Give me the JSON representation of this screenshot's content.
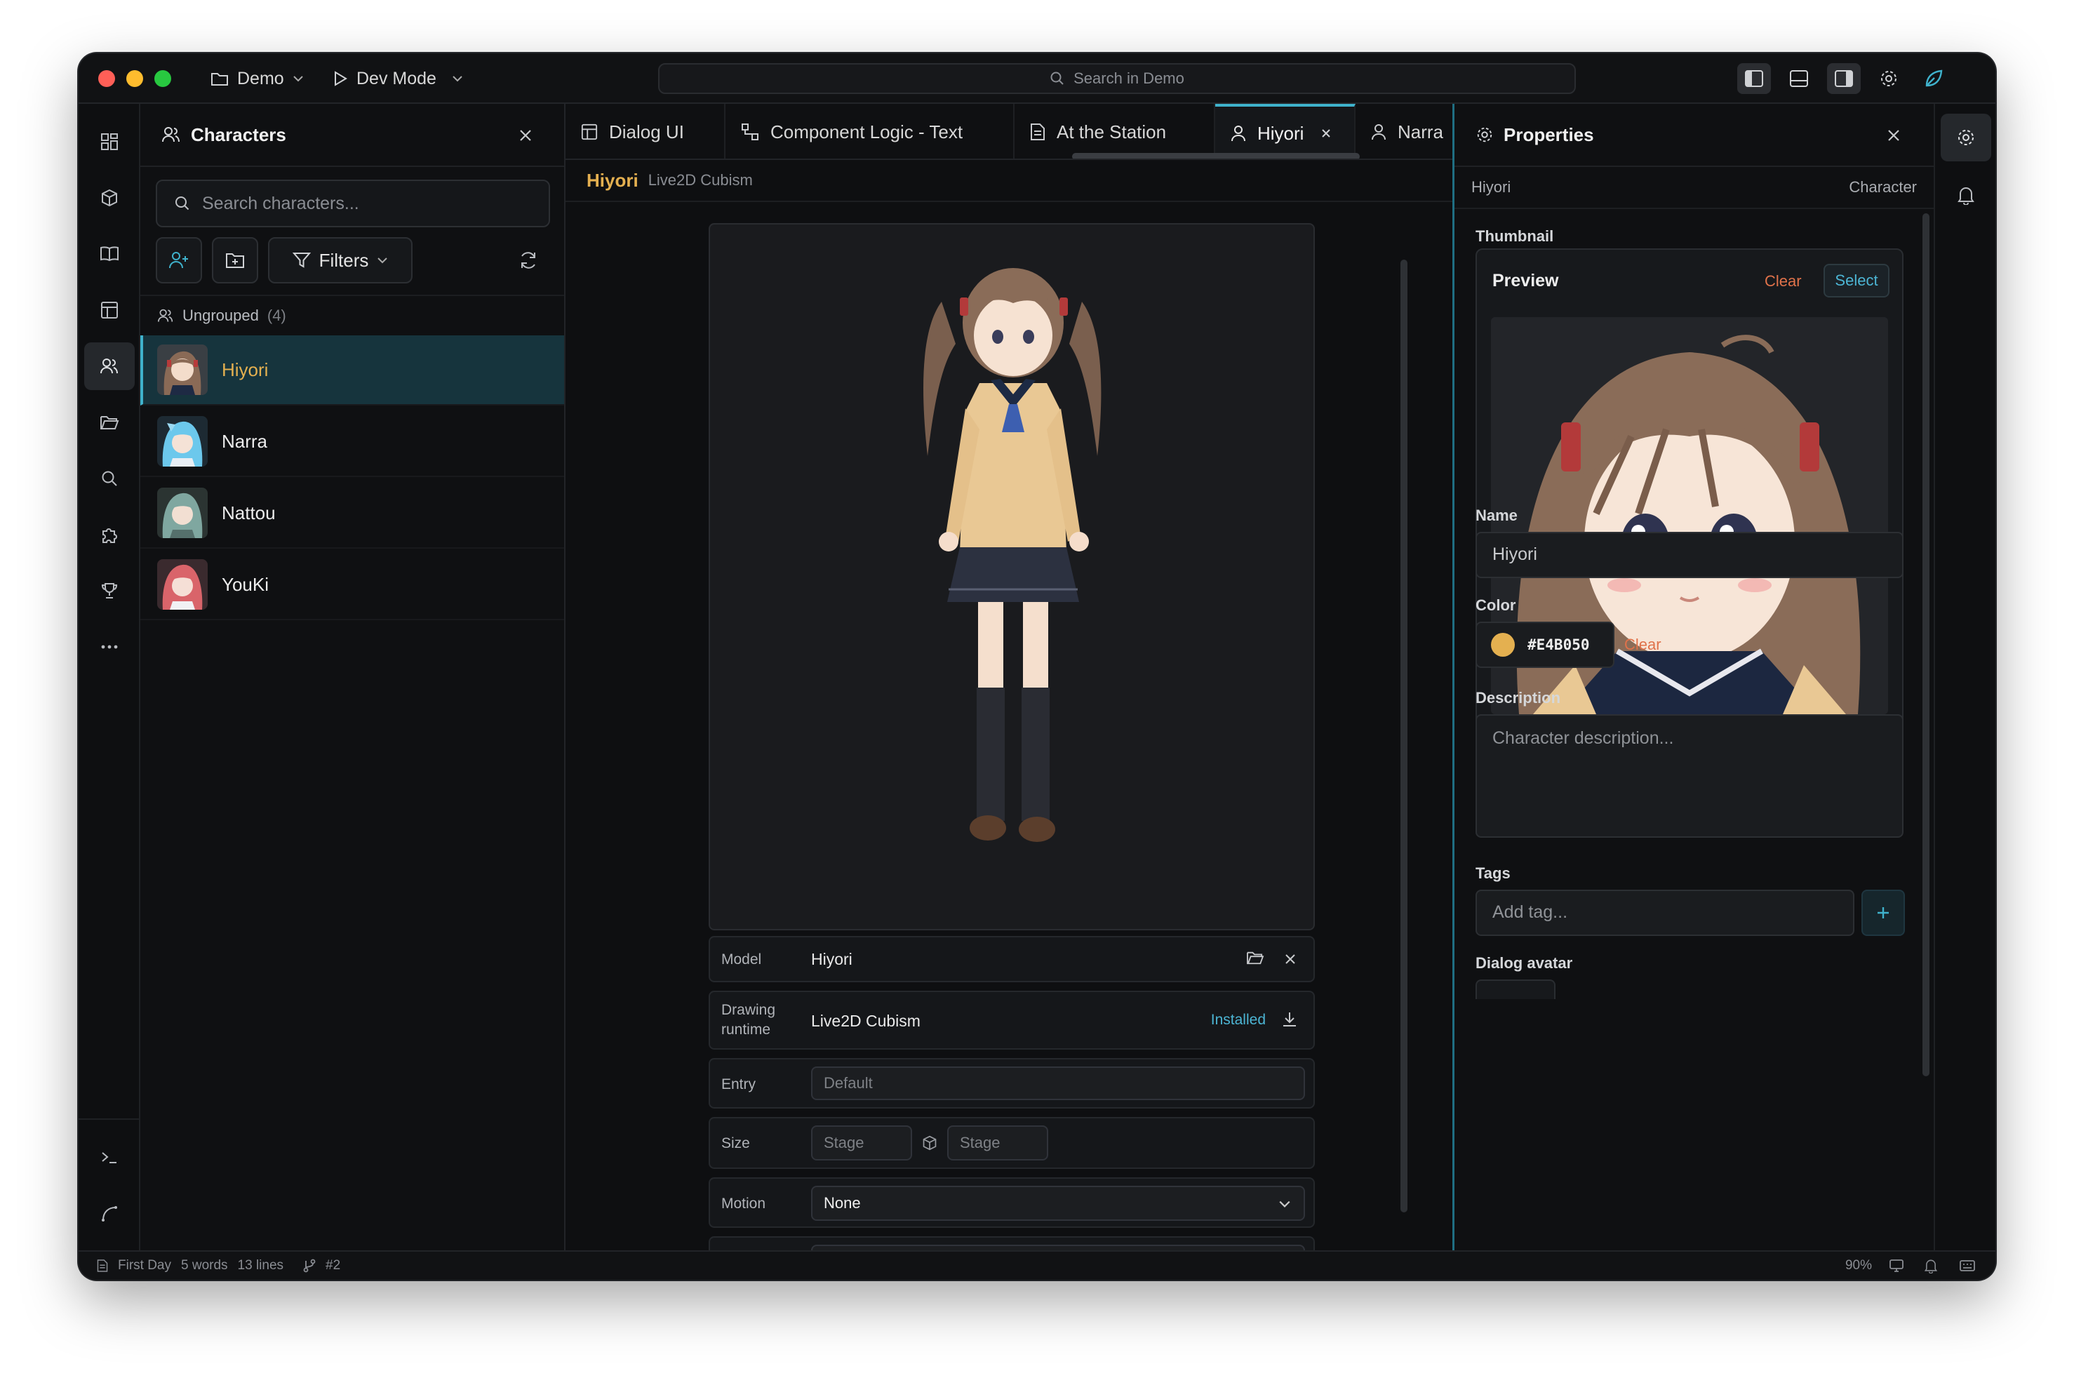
{
  "titlebar": {
    "project": "Demo",
    "mode": "Dev Mode",
    "search_placeholder": "Search in Demo"
  },
  "left_panel": {
    "title": "Characters",
    "search_placeholder": "Search characters...",
    "filters_label": "Filters",
    "group": {
      "name": "Ungrouped",
      "count": "(4)"
    },
    "characters": [
      {
        "name": "Hiyori",
        "selected": true
      },
      {
        "name": "Narra",
        "selected": false
      },
      {
        "name": "Nattou",
        "selected": false
      },
      {
        "name": "YouKi",
        "selected": false
      }
    ]
  },
  "tabs": [
    {
      "label": "Dialog UI",
      "icon": "layout-icon"
    },
    {
      "label": "Component Logic - Text",
      "icon": "logic-icon"
    },
    {
      "label": "At the Station",
      "icon": "document-icon"
    },
    {
      "label": "Hiyori",
      "icon": "user-icon",
      "active": true
    },
    {
      "label": "Narra",
      "icon": "user-icon"
    }
  ],
  "breadcrumb": {
    "title": "Hiyori",
    "subtitle": "Live2D Cubism"
  },
  "model_props": {
    "model_label": "Model",
    "model_value": "Hiyori",
    "runtime_label_1": "Drawing",
    "runtime_label_2": "runtime",
    "runtime_value": "Live2D Cubism",
    "runtime_status": "Installed",
    "entry_label": "Entry",
    "entry_placeholder": "Default",
    "size_label": "Size",
    "size_w_placeholder": "Stage",
    "size_h_placeholder": "Stage",
    "motion_label": "Motion",
    "motion_value": "None"
  },
  "properties": {
    "title": "Properties",
    "subject": "Hiyori",
    "subject_type": "Character",
    "thumbnail_label": "Thumbnail",
    "preview_label": "Preview",
    "clear_label": "Clear",
    "select_label": "Select",
    "name_label": "Name",
    "name_value": "Hiyori",
    "color_label": "Color",
    "color_value": "#E4B050",
    "color_clear": "Clear",
    "description_label": "Description",
    "description_placeholder": "Character description...",
    "tags_label": "Tags",
    "tags_placeholder": "Add tag...",
    "dialog_avatar_label": "Dialog avatar"
  },
  "statusbar": {
    "file": "First Day",
    "words": "5 words",
    "lines": "13 lines",
    "branch": "#2",
    "zoom": "90%"
  },
  "colors": {
    "accent": "#3fb2cc",
    "character_color": "#E4B050",
    "danger": "#e0724a"
  }
}
